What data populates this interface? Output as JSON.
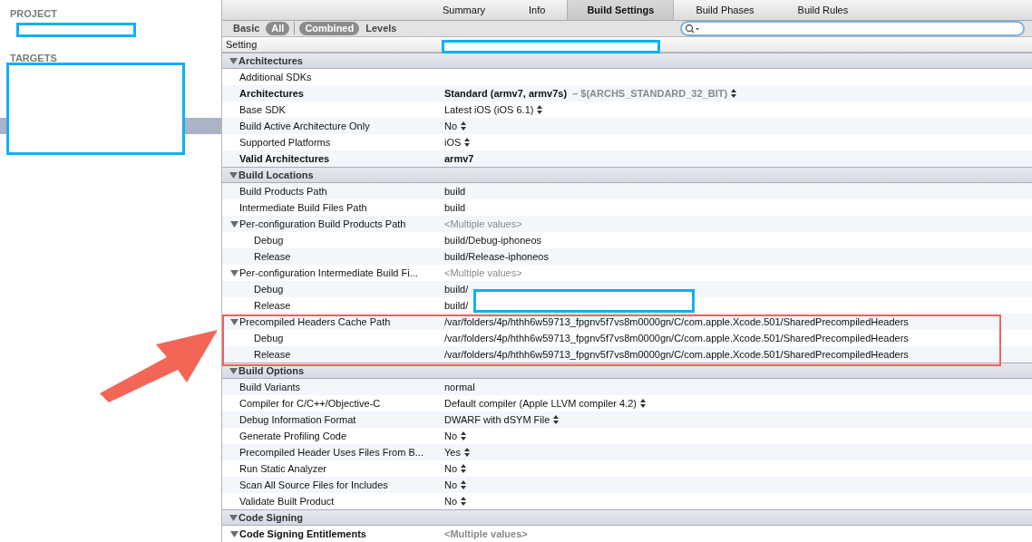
{
  "sidebar": {
    "groups": [
      {
        "label": "PROJECT"
      },
      {
        "label": "TARGETS"
      }
    ]
  },
  "tabs": [
    {
      "label": "Summary",
      "selected": false
    },
    {
      "label": "Info",
      "selected": false
    },
    {
      "label": "Build Settings",
      "selected": true
    },
    {
      "label": "Build Phases",
      "selected": false
    },
    {
      "label": "Build Rules",
      "selected": false
    }
  ],
  "filters": [
    {
      "label": "Basic",
      "selected": false
    },
    {
      "label": "All",
      "selected": true
    },
    {
      "label": "Combined",
      "selected": true
    },
    {
      "label": "Levels",
      "selected": false
    }
  ],
  "table": {
    "columns": [
      "Setting"
    ],
    "rows": [
      {
        "kind": "section",
        "name": "Architectures",
        "expanded": true
      },
      {
        "kind": "setting",
        "name": "Additional SDKs",
        "bold": false
      },
      {
        "kind": "setting",
        "name": "Architectures",
        "value": "Standard (armv7, armv7s)",
        "secondary_value": "–  $(ARCHS_STANDARD_32_BIT)",
        "bold": true,
        "stepper": true
      },
      {
        "kind": "setting",
        "name": "Base SDK",
        "value": "Latest iOS (iOS 6.1)",
        "bold": false,
        "stepper": true
      },
      {
        "kind": "setting",
        "name": "Build Active Architecture Only",
        "value": "No",
        "bold": false,
        "stepper": true
      },
      {
        "kind": "setting",
        "name": "Supported Platforms",
        "value": "iOS",
        "bold": false,
        "stepper": true
      },
      {
        "kind": "setting",
        "name": "Valid Architectures",
        "value": "armv7",
        "bold": true,
        "stepper": false
      },
      {
        "kind": "section",
        "name": "Build Locations",
        "expanded": true
      },
      {
        "kind": "setting",
        "name": "Build Products Path",
        "value": "build",
        "bold": false
      },
      {
        "kind": "setting",
        "name": "Intermediate Build Files Path",
        "value": "build",
        "bold": false
      },
      {
        "kind": "group",
        "name": "Per-configuration Build Products Path",
        "value": "<Multiple values>",
        "expanded": true
      },
      {
        "kind": "child",
        "name": "Debug",
        "value": "build/Debug-iphoneos"
      },
      {
        "kind": "child",
        "name": "Release",
        "value": "build/Release-iphoneos"
      },
      {
        "kind": "group",
        "name": "Per-configuration Intermediate Build Fi...",
        "value": "<Multiple values>",
        "expanded": true
      },
      {
        "kind": "child",
        "name": "Debug",
        "value": "build/"
      },
      {
        "kind": "child",
        "name": "Release",
        "value": "build/"
      },
      {
        "kind": "group",
        "name": "Precompiled Headers Cache Path",
        "value": "/var/folders/4p/hthh6w59713_fpgnv5f7vs8m0000gn/C/com.apple.Xcode.501/SharedPrecompiledHeaders",
        "expanded": true,
        "value_dimmed": false
      },
      {
        "kind": "child",
        "name": "Debug",
        "value": "/var/folders/4p/hthh6w59713_fpgnv5f7vs8m0000gn/C/com.apple.Xcode.501/SharedPrecompiledHeaders"
      },
      {
        "kind": "child",
        "name": "Release",
        "value": "/var/folders/4p/hthh6w59713_fpgnv5f7vs8m0000gn/C/com.apple.Xcode.501/SharedPrecompiledHeaders"
      },
      {
        "kind": "section",
        "name": "Build Options",
        "expanded": true
      },
      {
        "kind": "setting",
        "name": "Build Variants",
        "value": "normal",
        "bold": false
      },
      {
        "kind": "setting",
        "name": "Compiler for C/C++/Objective-C",
        "value": "Default compiler (Apple LLVM compiler 4.2)",
        "bold": false,
        "stepper": true
      },
      {
        "kind": "setting",
        "name": "Debug Information Format",
        "value": "DWARF with dSYM File",
        "bold": false,
        "stepper": true
      },
      {
        "kind": "setting",
        "name": "Generate Profiling Code",
        "value": "No",
        "bold": false,
        "stepper": true
      },
      {
        "kind": "setting",
        "name": "Precompiled Header Uses Files From B...",
        "value": "Yes",
        "bold": false,
        "stepper": true
      },
      {
        "kind": "setting",
        "name": "Run Static Analyzer",
        "value": "No",
        "bold": false,
        "stepper": true
      },
      {
        "kind": "setting",
        "name": "Scan All Source Files for Includes",
        "value": "No",
        "bold": false,
        "stepper": true
      },
      {
        "kind": "setting",
        "name": "Validate Built Product",
        "value": "No",
        "bold": false,
        "stepper": true
      },
      {
        "kind": "section",
        "name": "Code Signing",
        "expanded": true
      },
      {
        "kind": "group",
        "name": "Code Signing Entitlements",
        "value": "<Multiple values>",
        "expanded": true,
        "bold": true
      }
    ]
  }
}
